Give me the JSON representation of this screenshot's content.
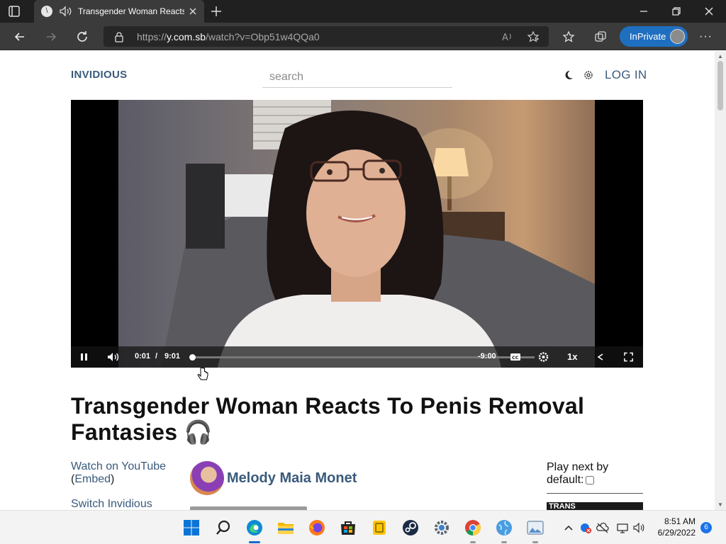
{
  "browser": {
    "tab_title": "Transgender Woman Reacts To Penis Removal Fantasies",
    "url_prefix": "https://",
    "url_domain": "y.com.sb",
    "url_path": "/watch?v=Obp51w4QQa0",
    "inprivate_label": "InPrivate",
    "more_label": "···",
    "favicon_letter": "\\"
  },
  "site": {
    "brand": "INVIDIOUS",
    "search_placeholder": "search",
    "login_label": "LOG IN"
  },
  "player": {
    "current_time": "0:01",
    "separator": "/",
    "duration": "9:01",
    "remaining": "-9:00",
    "speed": "1x",
    "progress_fraction": 0.002
  },
  "video": {
    "title": "Transgender Woman Reacts To Penis Removal Fantasies 🎧",
    "watch_on_youtube": "Watch on YouTube",
    "embed_open": "(",
    "embed_label": "Embed",
    "embed_close": ")",
    "switch_instance": "Switch Invidious",
    "channel_name": "Melody Maia Monet",
    "play_next_label": "Play next by default:",
    "recommended_thumb_text": "TRANS"
  },
  "taskbar": {
    "time": "8:51 AM",
    "date": "6/29/2022",
    "notification_count": "6"
  },
  "colors": {
    "link": "#3a5a7c",
    "chrome_dark": "#202020",
    "inprivate": "#1f6fc1"
  }
}
